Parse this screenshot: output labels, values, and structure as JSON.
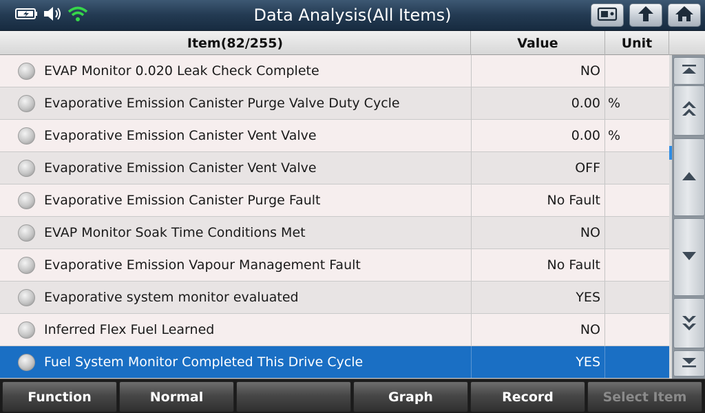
{
  "header": {
    "title": "Data Analysis(All Items)",
    "status_icons": [
      "battery-charging-icon",
      "speaker-icon",
      "wifi-icon"
    ],
    "buttons": [
      "screenshot-icon",
      "back-up-icon",
      "home-icon"
    ]
  },
  "table": {
    "columns": {
      "item": "Item(82/255)",
      "value": "Value",
      "unit": "Unit"
    },
    "rows": [
      {
        "name": "EVAP Monitor 0.020 Leak Check Complete",
        "value": "NO",
        "unit": ""
      },
      {
        "name": "Evaporative Emission Canister Purge Valve Duty Cycle",
        "value": "0.00",
        "unit": "%"
      },
      {
        "name": "Evaporative Emission Canister Vent Valve",
        "value": "0.00",
        "unit": "%"
      },
      {
        "name": "Evaporative Emission Canister Vent Valve",
        "value": "OFF",
        "unit": ""
      },
      {
        "name": "Evaporative Emission Canister Purge Fault",
        "value": "No Fault",
        "unit": ""
      },
      {
        "name": "EVAP Monitor Soak Time Conditions Met",
        "value": "NO",
        "unit": ""
      },
      {
        "name": "Evaporative Emission Vapour Management Fault",
        "value": "No Fault",
        "unit": ""
      },
      {
        "name": "Evaporative system monitor evaluated",
        "value": "YES",
        "unit": ""
      },
      {
        "name": "Inferred Flex Fuel Learned",
        "value": "NO",
        "unit": ""
      },
      {
        "name": "Fuel System Monitor Completed This Drive Cycle",
        "value": "YES",
        "unit": ""
      }
    ],
    "selected_index": 9
  },
  "scroll": {
    "buttons": [
      "scroll-top-icon",
      "page-up-icon",
      "line-up-icon",
      "line-down-icon",
      "page-down-icon",
      "scroll-bottom-icon"
    ]
  },
  "footer": {
    "function": "Function",
    "normal": "Normal",
    "empty": "",
    "graph": "Graph",
    "record": "Record",
    "select_item": "Select Item"
  },
  "colors": {
    "title_bar": "#233a52",
    "selected_row": "#1a6fc4",
    "row_light": "#f6eeee",
    "row_dark": "#e8e4e4",
    "disabled_text": "#8a8a8a"
  }
}
